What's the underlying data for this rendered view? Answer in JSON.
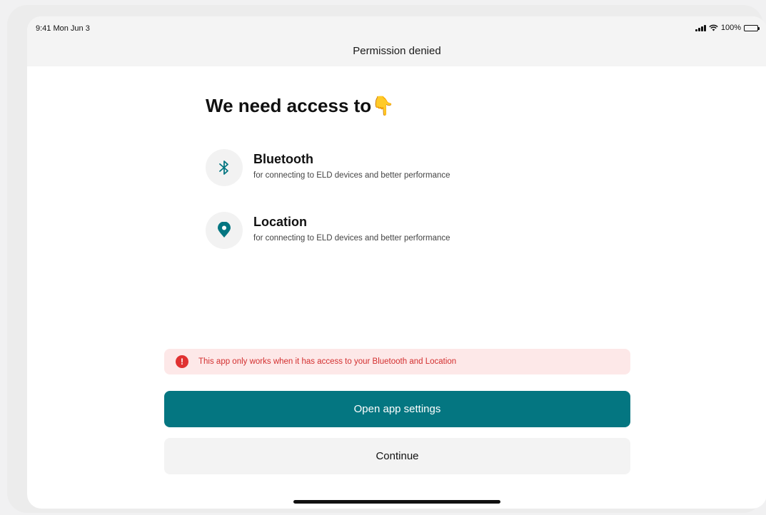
{
  "status_bar": {
    "time": "9:41 Mon Jun 3",
    "battery_text": "100%"
  },
  "nav": {
    "title": "Permission denied"
  },
  "main": {
    "headline": "We need access to👇",
    "permissions": [
      {
        "icon": "bluetooth-icon",
        "title": "Bluetooth",
        "description": "for connecting to ELD devices and better performance"
      },
      {
        "icon": "location-pin-icon",
        "title": "Location",
        "description": "for connecting to ELD devices and better performance"
      }
    ]
  },
  "alert": {
    "icon": "error-icon",
    "icon_glyph": "!",
    "text": "This app only works when it has access to your Bluetooth and Location"
  },
  "actions": {
    "primary_label": "Open app settings",
    "secondary_label": "Continue"
  },
  "colors": {
    "accent": "#047681",
    "error": "#e03131",
    "error_bg": "#fde8e8"
  }
}
